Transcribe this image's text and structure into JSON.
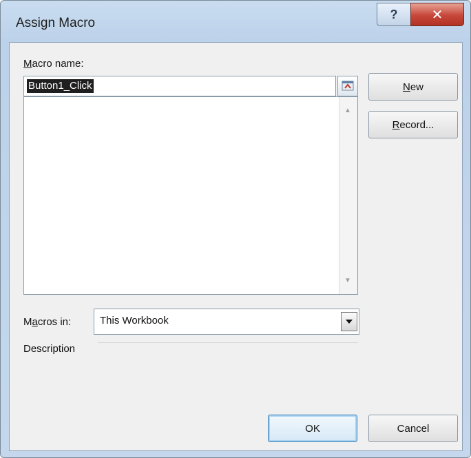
{
  "window": {
    "title": "Assign Macro",
    "help_glyph": "?",
    "close_glyph": "✕"
  },
  "macro_name": {
    "label_access_key": "M",
    "label_rest": "acro name:",
    "value": "Button1_Click"
  },
  "buttons": {
    "new_key": "N",
    "new_rest": "ew",
    "record_key": "R",
    "record_rest": "ecord...",
    "ok": "OK",
    "cancel": "Cancel"
  },
  "macros_in": {
    "label_pre": "M",
    "label_key": "a",
    "label_rest": "cros in:",
    "value": "This Workbook"
  },
  "description": {
    "label": "Description"
  },
  "icons": {
    "help": "help-icon",
    "close": "close-icon",
    "collapse": "collapse-dialog-icon",
    "scroll_up": "scroll-up-arrow-icon",
    "scroll_down": "scroll-down-arrow-icon",
    "dropdown": "dropdown-arrow-icon"
  }
}
